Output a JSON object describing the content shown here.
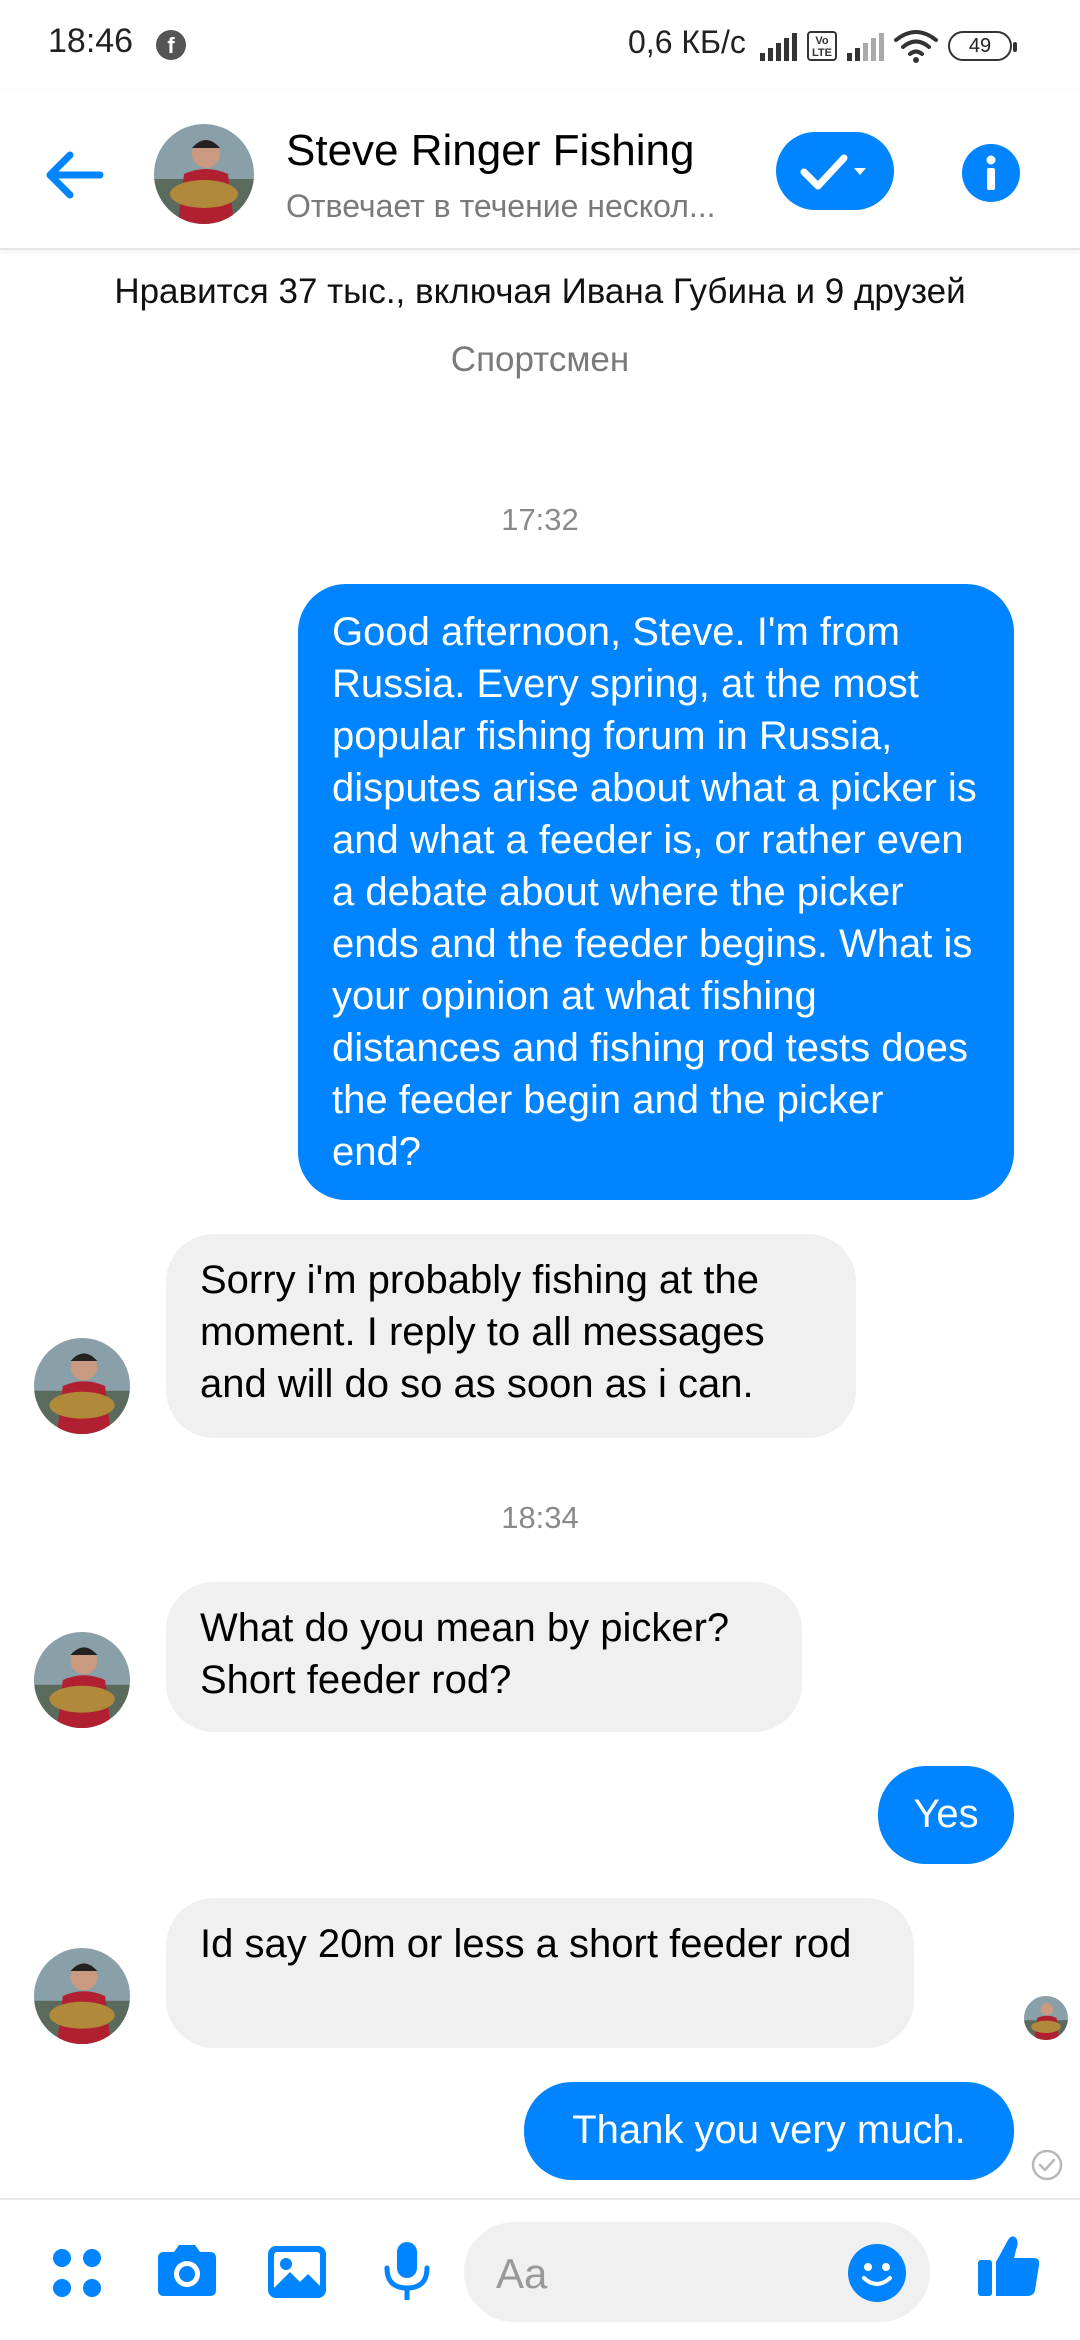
{
  "status_bar": {
    "time": "18:46",
    "network_speed": "0,6 КБ/с",
    "battery": "49",
    "volte": "Vo LTE"
  },
  "header": {
    "name": "Steve Ringer Fishing",
    "subtitle": "Отвечает в течение нескол..."
  },
  "profile": {
    "likes": "Нравится 37 тыс., включая Ивана Губина и 9 друзей",
    "category": "Спортсмен"
  },
  "conversation": {
    "timestamp_1": "17:32",
    "msg_1": "Good afternoon, Steve.  I'm from Russia.  Every spring, at the most popular fishing forum in Russia, disputes arise about what a picker is and what a feeder is, or rather even a debate about where the picker ends and the feeder begins.  What is your opinion at what fishing distances and fishing rod tests does the feeder begin and the picker end?",
    "msg_2": "Sorry i'm probably fishing at the moment. I reply to all messages and will do so as soon as i can.",
    "timestamp_2": "18:34",
    "msg_3": "What do you mean by picker? Short feeder rod?",
    "msg_4": "Yes",
    "msg_5": "Id say 20m or less a short feeder rod",
    "msg_6": "Thank you very much."
  },
  "composer": {
    "placeholder": "Aa"
  },
  "colors": {
    "accent": "#0084ff",
    "incoming_bubble": "#f1f0f0",
    "outgoing_bubble": "#0084ff"
  },
  "icons": {
    "back": "arrow-left-icon",
    "check": "check-dropdown-icon",
    "info": "info-icon",
    "apps": "four-dots-icon",
    "camera": "camera-icon",
    "gallery": "image-icon",
    "mic": "microphone-icon",
    "emoji": "smiley-icon",
    "like": "thumbs-up-icon"
  }
}
